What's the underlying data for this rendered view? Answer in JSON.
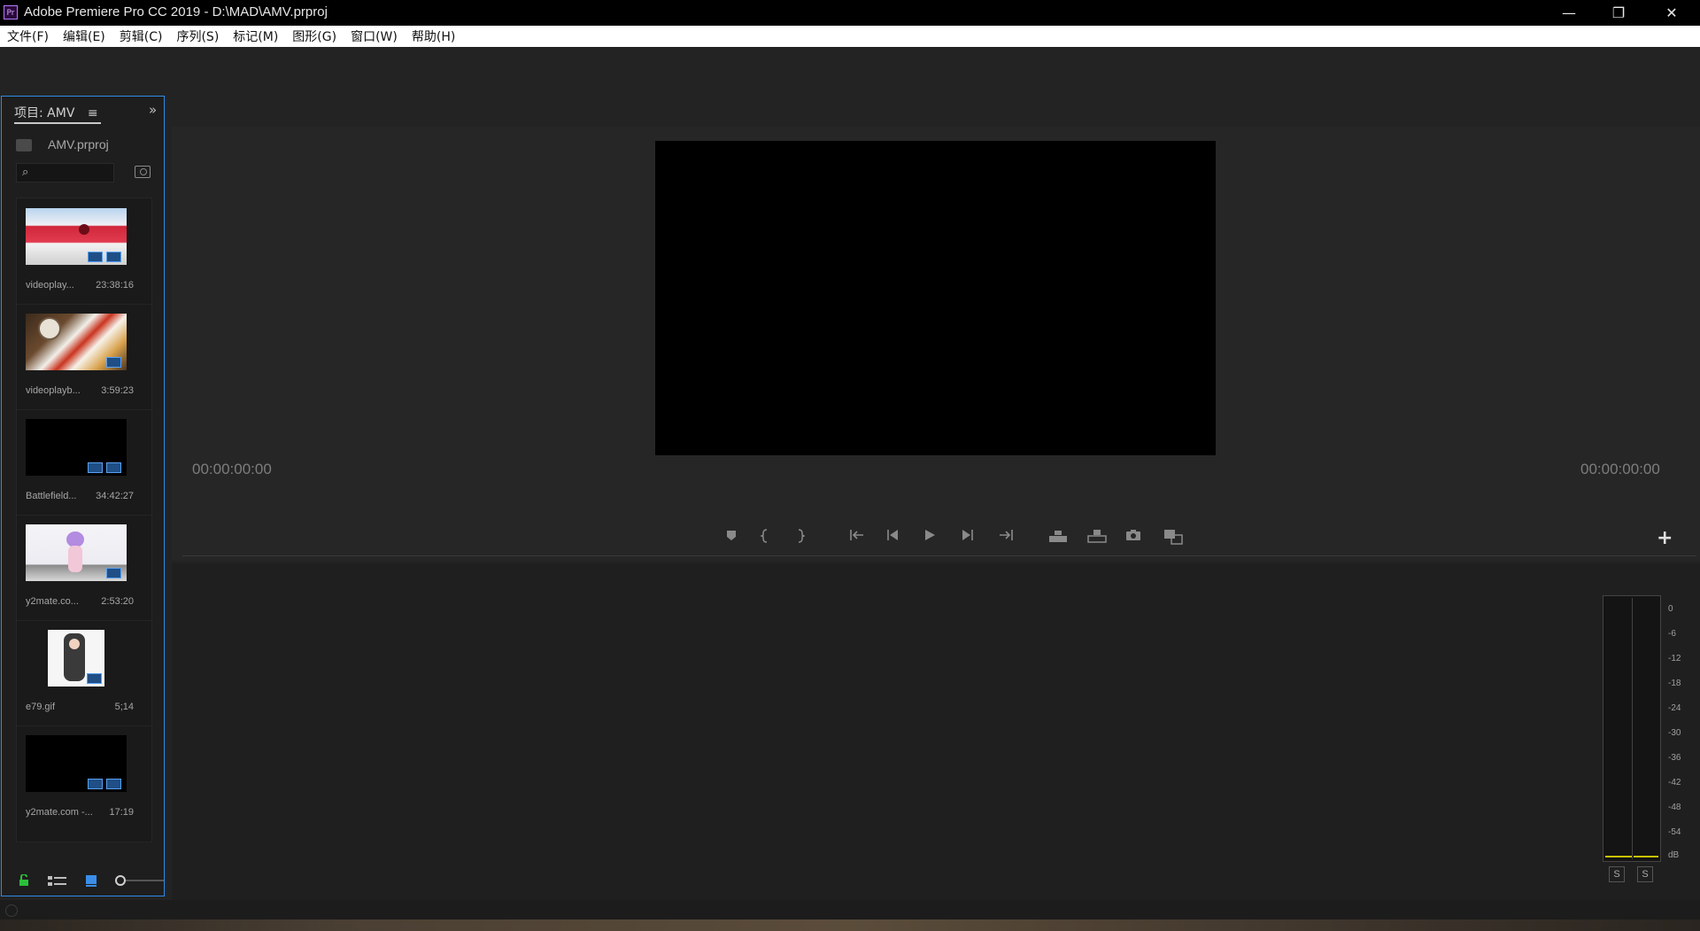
{
  "window": {
    "app_logo": "Pr",
    "title": "Adobe Premiere Pro CC 2019 - D:\\MAD\\AMV.prproj",
    "minimize": "—",
    "restore": "❐",
    "close": "✕"
  },
  "menu": [
    "文件(F)",
    "编辑(E)",
    "剪辑(C)",
    "序列(S)",
    "标记(M)",
    "图形(G)",
    "窗口(W)",
    "帮助(H)"
  ],
  "project": {
    "tab_label": "项目: AMV",
    "tab_menu": "≡",
    "expand": "»",
    "file_name": "AMV.prproj",
    "search_icon": "⌕",
    "clips": [
      {
        "name": "videoplay...",
        "duration": "23:38:16",
        "thumb": "red-car"
      },
      {
        "name": "videoplayb...",
        "duration": "3:59:23",
        "thumb": "food"
      },
      {
        "name": "Battlefield...",
        "duration": "34:42:27",
        "thumb": "black"
      },
      {
        "name": "y2mate.co...",
        "duration": "2:53:20",
        "thumb": "anime-girl"
      },
      {
        "name": "e79.gif",
        "duration": "5;14",
        "thumb": "gif-character"
      },
      {
        "name": "y2mate.com -...",
        "duration": "17:19",
        "thumb": "black"
      }
    ]
  },
  "monitor": {
    "timecode_left": "00:00:00:00",
    "timecode_right": "00:00:00:00",
    "add_button": "+",
    "controls": [
      "marker-icon",
      "mark-in-icon",
      "mark-out-icon",
      "go-to-in-icon",
      "step-back-icon",
      "play-icon",
      "step-forward-icon",
      "go-to-out-icon",
      "lift-icon",
      "extract-icon",
      "export-frame-icon",
      "compare-icon"
    ]
  },
  "meter": {
    "db_labels": [
      "0",
      "-6",
      "-12",
      "-18",
      "-24",
      "-30",
      "-36",
      "-42",
      "-48",
      "-54",
      "dB"
    ],
    "solo_left": "S",
    "solo_right": "S",
    "peak_color": "#c9c200"
  },
  "colors": {
    "panel_focus": "#2d8ceb",
    "badge": "#1f4f86"
  }
}
